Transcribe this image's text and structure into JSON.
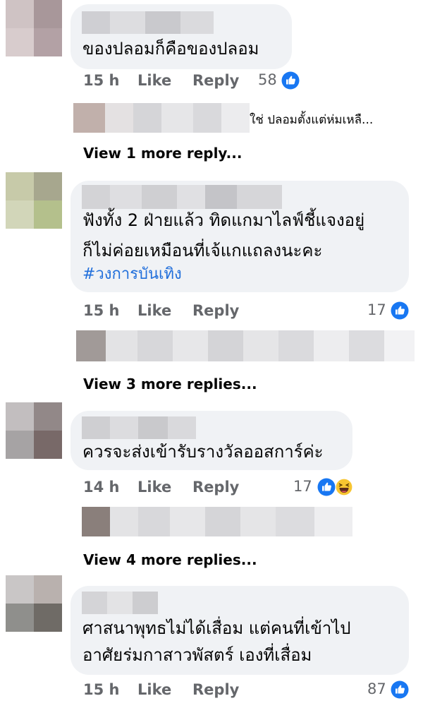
{
  "comments": [
    {
      "text_lines": [
        "ของปลอมก็คือของปลอม"
      ],
      "time": "15 h",
      "like_label": "Like",
      "reply_label": "Reply",
      "reaction_count": "58",
      "reactions": [
        "like-icon"
      ],
      "reply_preview": "ใช่ ปลอมตั้งแต่ห่มเหลื...",
      "view_more": "View 1 more reply..."
    },
    {
      "text_lines": [
        "ฟังทั้ง 2 ฝ่ายแล้ว ทิดแกมาไลฟ์ชี้แจงอยู่",
        "ก็ไม่ค่อยเหมือนที่เจ้แกแถลงนะคะ"
      ],
      "hashtag": "#วงการบันเทิง",
      "time": "15 h",
      "like_label": "Like",
      "reply_label": "Reply",
      "reaction_count": "17",
      "reactions": [
        "like-icon"
      ],
      "view_more": "View 3 more replies..."
    },
    {
      "text_lines": [
        "ควรจะส่งเข้ารับรางวัลออสการ์ค่ะ"
      ],
      "time": "14 h",
      "like_label": "Like",
      "reply_label": "Reply",
      "reaction_count": "17",
      "reactions": [
        "like-icon",
        "haha-icon"
      ],
      "view_more": "View 4 more replies..."
    },
    {
      "text_lines": [
        "ศาสนาพุทธไม่ได้เสื่อม แต่คนที่เข้าไป",
        "อาศัยร่มกาสาวพัสตร์ เองที่เสื่อม"
      ],
      "time": "15 h",
      "like_label": "Like",
      "reply_label": "Reply",
      "reaction_count": "87",
      "reactions": [
        "like-icon"
      ]
    }
  ],
  "colors": {
    "bubble_bg": "#f0f2f5",
    "meta_text": "#65676b",
    "hashtag": "#216fdb",
    "like_blue": "#1877f2"
  }
}
